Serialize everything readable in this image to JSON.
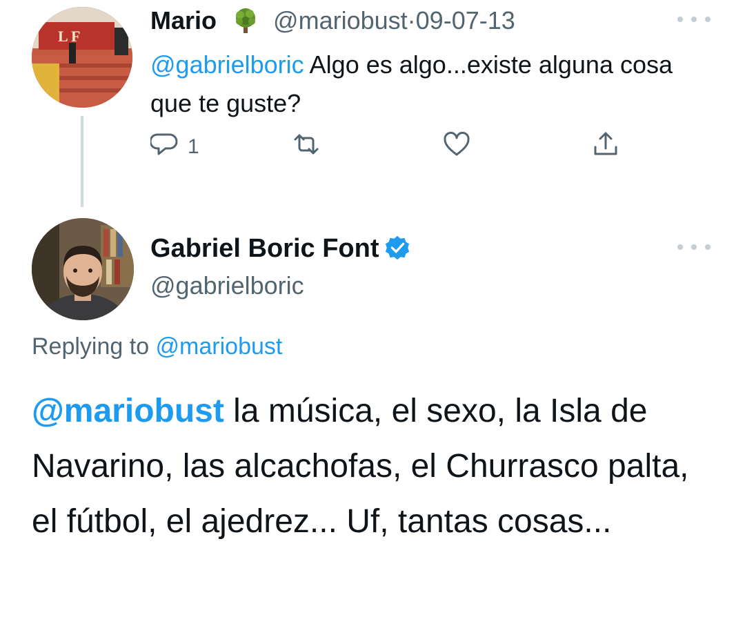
{
  "tweet1": {
    "display_name": "Mario",
    "handle": "@mariobust",
    "separator": "·",
    "date": "09-07-13",
    "mention": "@gabrielboric",
    "text": " Algo es algo...existe alguna cosa que te guste?",
    "reply_count": "1",
    "avatar_sign_text": "L F"
  },
  "tweet2": {
    "display_name": "Gabriel Boric Font",
    "handle": "@gabrielboric",
    "replying_prefix": "Replying to ",
    "replying_handle": "@mariobust",
    "mention": "@mariobust",
    "text": " la música, el sexo, la Isla de Navarino, las alcachofas, el Churrasco palta, el fútbol, el ajedrez... Uf, tantas cosas..."
  },
  "colors": {
    "link": "#1d9bf0",
    "muted": "#536471",
    "text": "#0f1419",
    "thread_line": "#cfd9de"
  },
  "icons": {
    "tree": "tree-emoji-icon",
    "verified": "verified-badge-icon",
    "reply": "reply-icon",
    "retweet": "retweet-icon",
    "like": "like-icon",
    "share": "share-icon",
    "more": "more-options-icon"
  }
}
